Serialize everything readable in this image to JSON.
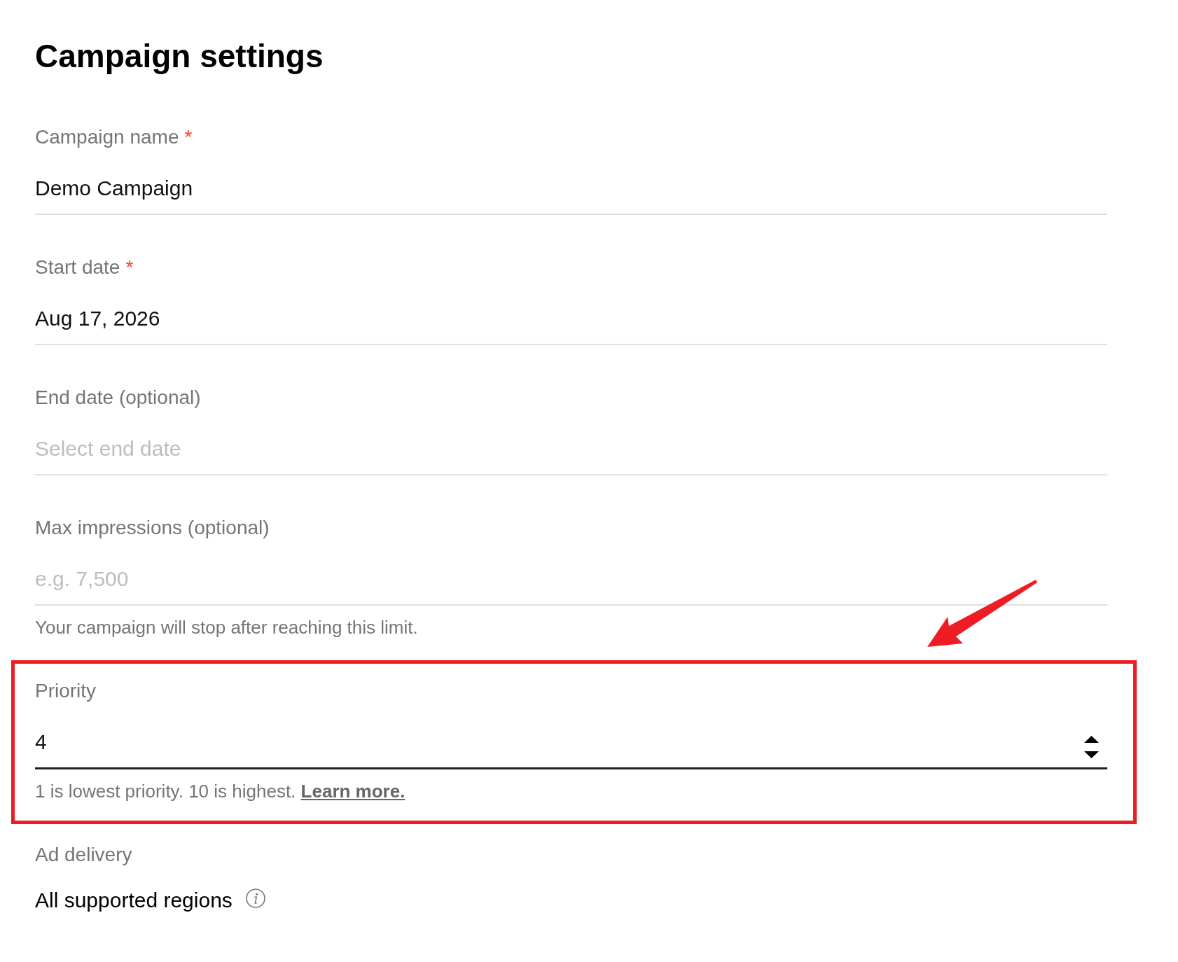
{
  "page": {
    "title": "Campaign settings"
  },
  "fields": [
    {
      "kind": "text",
      "label": "Campaign name",
      "required_mark": "*",
      "value": "Demo Campaign",
      "focused": false,
      "highlighted": false
    },
    {
      "kind": "text",
      "label": "Start date",
      "required_mark": "*",
      "value": "Aug 17, 2026",
      "focused": false,
      "highlighted": false
    },
    {
      "kind": "text",
      "label": "End date (optional)",
      "placeholder": "Select end date",
      "focused": false,
      "highlighted": false
    },
    {
      "kind": "text",
      "label": "Max impressions (optional)",
      "placeholder": "e.g. 7,500",
      "helper": "Your campaign will stop after reaching this limit.",
      "focused": false,
      "highlighted": false
    },
    {
      "kind": "number",
      "label": "Priority",
      "value": "4",
      "helper": "1 is lowest priority. 10 is highest.",
      "helper_link": "Learn more.",
      "focused": true,
      "highlighted": true
    }
  ],
  "ad_delivery": {
    "label": "Ad delivery",
    "value": "All supported regions"
  }
}
